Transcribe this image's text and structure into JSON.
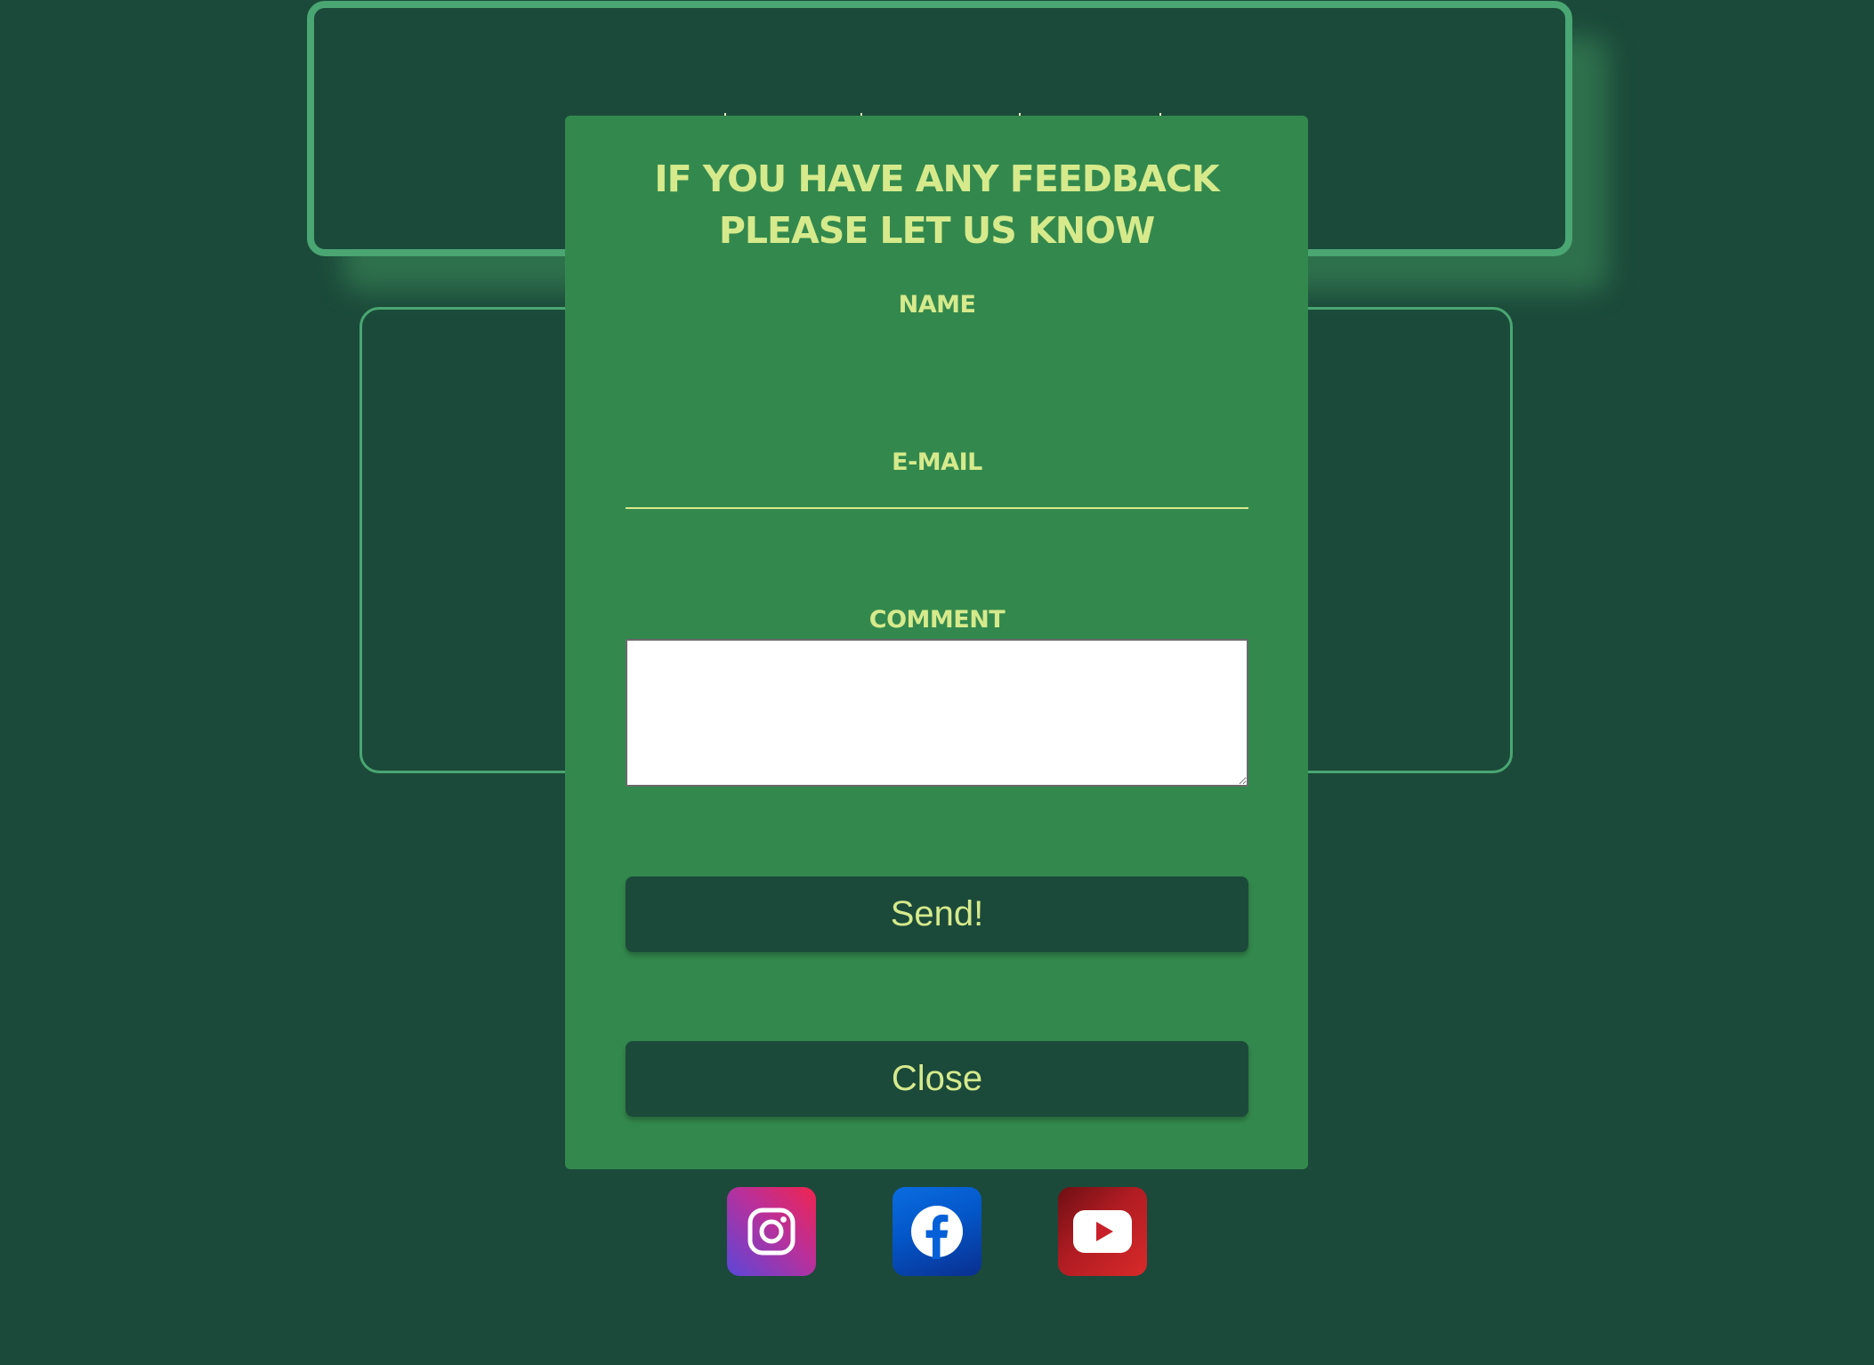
{
  "modal": {
    "title": "IF YOU HAVE ANY FEEDBACK PLEASE LET US KNOW",
    "name_label": "NAME",
    "name_value": "",
    "email_label": "E-MAIL",
    "email_value": "",
    "comment_label": "COMMENT",
    "comment_value": "",
    "send_label": "Send!",
    "close_label": "Close"
  },
  "social": [
    {
      "icon": "instagram-icon"
    },
    {
      "icon": "facebook-icon"
    },
    {
      "icon": "youtube-icon"
    }
  ],
  "colors": {
    "page_background": "#1b4a3a",
    "modal_background": "#33894d",
    "accent_text": "#d6ea8c",
    "card_border": "#4aa672",
    "button_background": "#1b4a3a"
  }
}
